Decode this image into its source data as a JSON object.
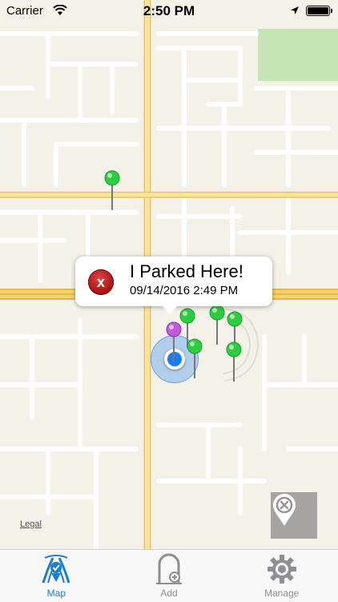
{
  "status_bar": {
    "carrier": "Carrier",
    "time": "2:50 PM",
    "wifi_icon": "wifi-icon",
    "location_icon": "location-arrow-icon",
    "battery_icon": "battery-full-icon"
  },
  "map": {
    "legal_label": "Legal",
    "callout": {
      "title": "I Parked Here!",
      "subtitle": "09/14/2016 2:49 PM",
      "delete_icon": "x",
      "delete_color": "#c0171a"
    },
    "pin_colors": {
      "green": "#2ecc40",
      "purple": "#c05ad8",
      "user_location": "#1a7ef2"
    },
    "find_button_icon": "location-cancel-icon"
  },
  "tab_bar": {
    "tabs": [
      {
        "label": "Map",
        "icon": "map-parking-icon",
        "active": true
      },
      {
        "label": "Add",
        "icon": "add-parking-icon",
        "active": false
      },
      {
        "label": "Manage",
        "icon": "gear-icon",
        "active": false
      }
    ],
    "active_color": "#1b7ed0",
    "inactive_color": "#8e8e93"
  }
}
